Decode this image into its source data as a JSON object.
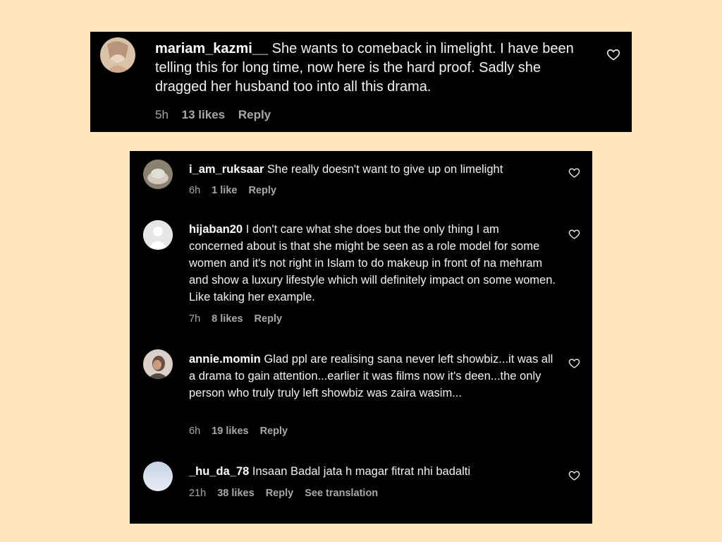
{
  "top_comment": {
    "username": "mariam_kazmi__",
    "text": "She wants to comeback in limelight. I have been telling this for long time, now here is the hard proof. Sadly she dragged her husband too into all this drama.",
    "time": "5h",
    "likes": "13 likes",
    "reply": "Reply"
  },
  "comments": [
    {
      "username": "i_am_ruksaar",
      "text": "She really doesn't want to give up on limelight",
      "time": "6h",
      "likes": "1 like",
      "reply": "Reply"
    },
    {
      "username": "hijaban20",
      "text": "I don't care what she does but the only thing I am concerned about is that she might be seen as a role model for some women and it's not right in Islam to do makeup in front of na mehram and show a luxury lifestyle which will definitely impact on some women. Like taking her example.",
      "time": "7h",
      "likes": "8 likes",
      "reply": "Reply"
    },
    {
      "username": "annie.momin",
      "text": "Glad ppl are realising sana never left showbiz...it was all a drama to gain attention...earlier it was films now it's deen...the only person who truly truly left showbiz was zaira wasim...",
      "time": "6h",
      "likes": "19 likes",
      "reply": "Reply"
    },
    {
      "username": "_hu_da_78",
      "text": "Insaan Badal jata h magar fitrat nhi badalti",
      "time": "21h",
      "likes": "38 likes",
      "reply": "Reply",
      "see_translation": "See translation"
    }
  ],
  "colors": {
    "background": "#fde6bc",
    "panel": "#000000",
    "meta": "#a8a8a8"
  }
}
